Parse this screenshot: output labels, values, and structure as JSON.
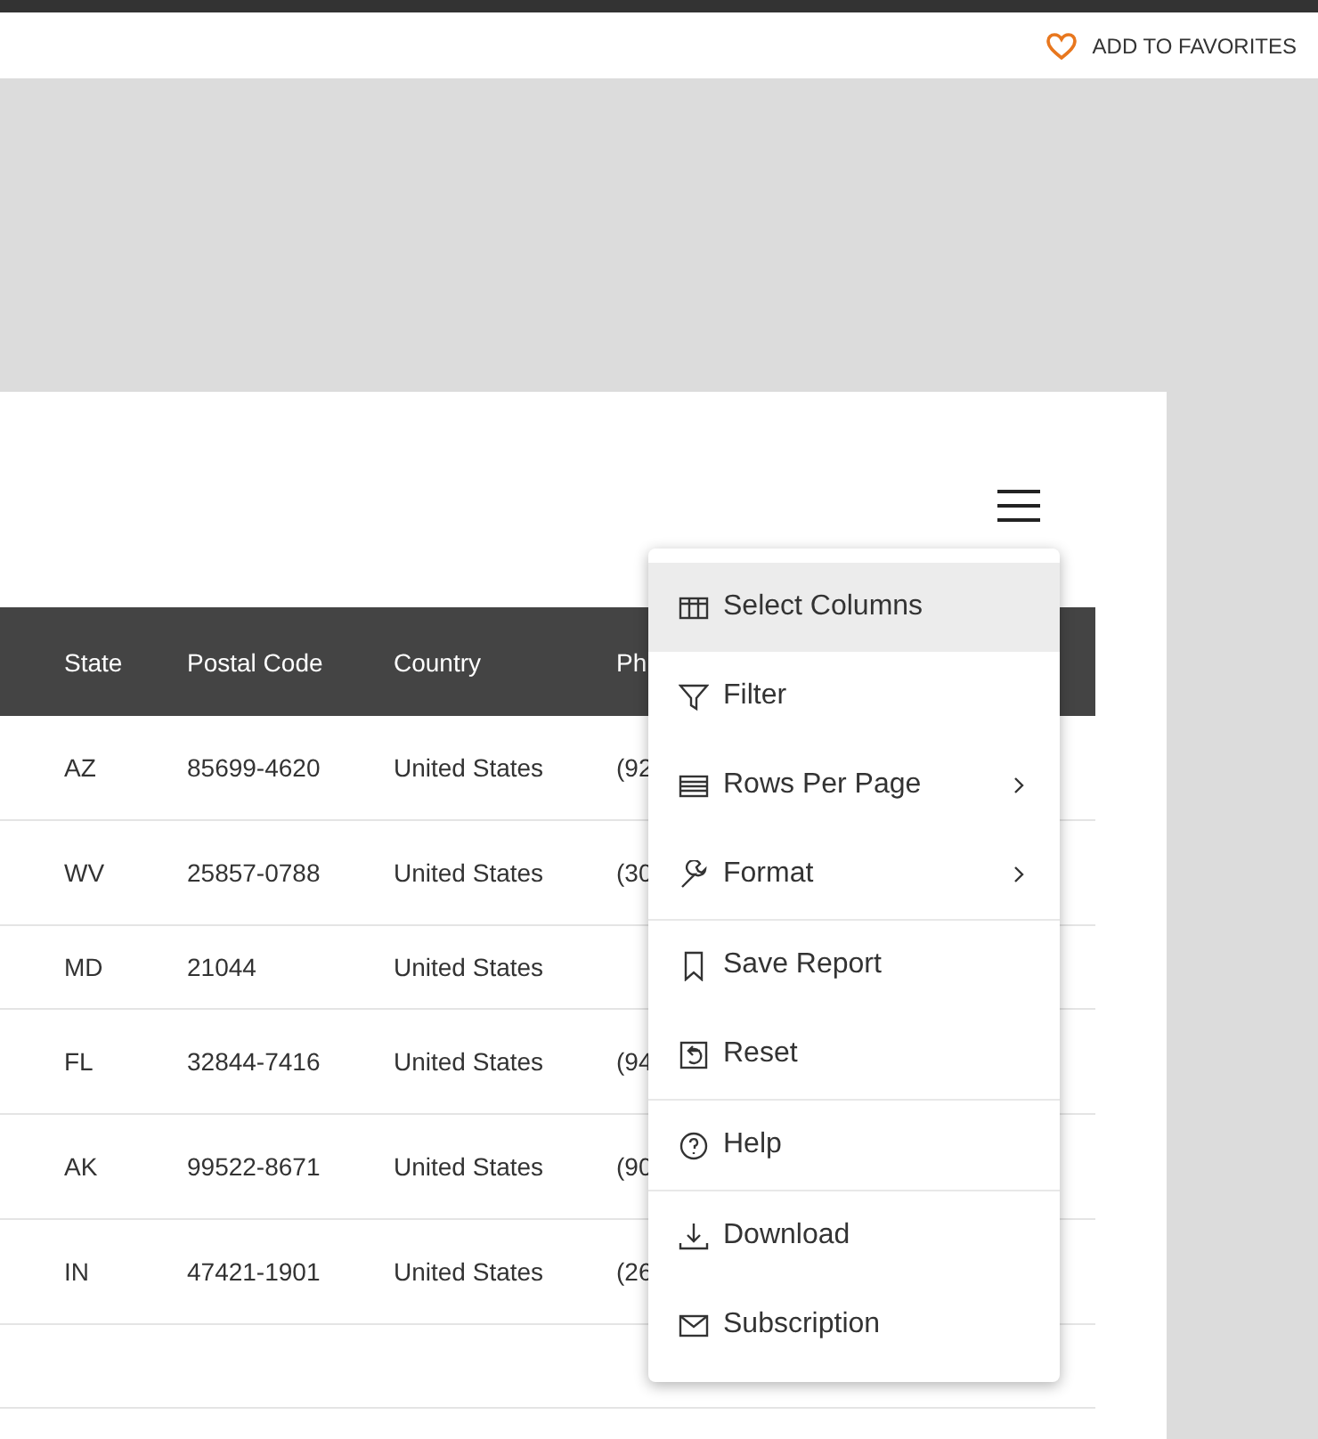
{
  "header": {
    "favorites_link": "ADD TO FAVORITES"
  },
  "table": {
    "columns": [
      "State",
      "Postal Code",
      "Country",
      "Ph"
    ],
    "rows": [
      [
        "AZ",
        "85699-4620",
        "United States",
        "(92"
      ],
      [
        "WV",
        "25857-0788",
        "United States",
        "(30"
      ],
      [
        "MD",
        "21044",
        "United States",
        ""
      ],
      [
        "FL",
        "32844-7416",
        "United States",
        "(94"
      ],
      [
        "AK",
        "99522-8671",
        "United States",
        "(90"
      ],
      [
        "IN",
        "47421-1901",
        "United States",
        "(26"
      ]
    ]
  },
  "menu": {
    "groups": [
      [
        {
          "kind": "columns",
          "label": "Select Columns",
          "selected": true,
          "submenu": false
        },
        {
          "kind": "filter",
          "label": "Filter",
          "selected": false,
          "submenu": false
        },
        {
          "kind": "rows",
          "label": "Rows Per Page",
          "selected": false,
          "submenu": true
        },
        {
          "kind": "format",
          "label": "Format",
          "selected": false,
          "submenu": true
        }
      ],
      [
        {
          "kind": "save",
          "label": "Save Report",
          "selected": false,
          "submenu": false
        },
        {
          "kind": "reset",
          "label": "Reset",
          "selected": false,
          "submenu": false
        }
      ],
      [
        {
          "kind": "help",
          "label": "Help",
          "selected": false,
          "submenu": false
        }
      ],
      [
        {
          "kind": "download",
          "label": "Download",
          "selected": false,
          "submenu": false
        },
        {
          "kind": "subscription",
          "label": "Subscription",
          "selected": false,
          "submenu": false
        }
      ]
    ]
  }
}
